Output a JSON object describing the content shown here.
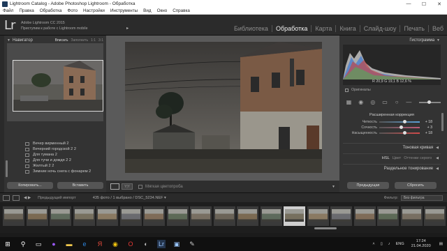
{
  "window": {
    "title": "Lightroom Catalog - Adobe Photoshop Lightroom - Обработка",
    "controls": [
      "—",
      "☐",
      "✕"
    ]
  },
  "menu": [
    "Файл",
    "Правка",
    "Обработка",
    "Фото",
    "Настройки",
    "Инструменты",
    "Вид",
    "Окно",
    "Справка"
  ],
  "identity": {
    "logo": "Lr",
    "line1": "Adobe Lightroom CC 2015",
    "line2": "Приступим к работе с Lightroom mobile",
    "arrow": "►"
  },
  "modules": {
    "items": [
      "Библиотека",
      "Обработка",
      "Карта",
      "Книга",
      "Слайд-шоу",
      "Печать",
      "Веб"
    ],
    "active": "Обработка"
  },
  "navigator": {
    "title": "Навигатор",
    "options": [
      "Вписать",
      "Заполнить",
      "1:1",
      "3:1"
    ],
    "active_option": "Вписать"
  },
  "presets": [
    "Вечер вирменный 2",
    "Вечерний городской 2 2",
    "Для тумана 2",
    "Для тучи и дождя 2 2",
    "Желтый 2 2",
    "Зимние ночь снега с фонарем 2"
  ],
  "left_buttons": {
    "copy": "Копировать...",
    "paste": "Вставить"
  },
  "toolbar": {
    "softproof": "Мягкая цветопроба",
    "compare": "Y|Y"
  },
  "histogram": {
    "title": "Гистограмма",
    "values": "R 20,9  G 19,1  B 12,6 %",
    "original_label": "Оригиналы"
  },
  "presence": {
    "title": "Расширенная коррекция",
    "sliders": [
      {
        "label": "Четкость",
        "value": "+ 18",
        "level": 0.62,
        "color": "#5aa0d8"
      },
      {
        "label": "Сочность",
        "value": "+ 3",
        "level": 0.53,
        "color": "#c05a78"
      },
      {
        "label": "Насыщенность",
        "value": "+ 18",
        "level": 0.62,
        "color": "#d04a4a"
      }
    ]
  },
  "sections": {
    "tone_curve": "Тоновая кривая",
    "hsl_tabs": [
      "HSL",
      "Цвет",
      "Оттенки серого"
    ],
    "hsl_active": "HSL",
    "split_toning": "Раздельное тонирование"
  },
  "right_buttons": {
    "previous": "Предыдущая",
    "reset": "Сбросить"
  },
  "filmstrip_bar": {
    "import": "Предыдущий импорт",
    "info": "435 фото / 1 выбрано / DSC_5234.NEF ▾",
    "filter_label": "Фильтр:",
    "filter_value": "Без фильтра"
  },
  "thumbnails": {
    "count": 19,
    "selected": 12
  },
  "taskbar": {
    "lang": "ENG",
    "time": "17:24",
    "date": "21.04.2020"
  }
}
